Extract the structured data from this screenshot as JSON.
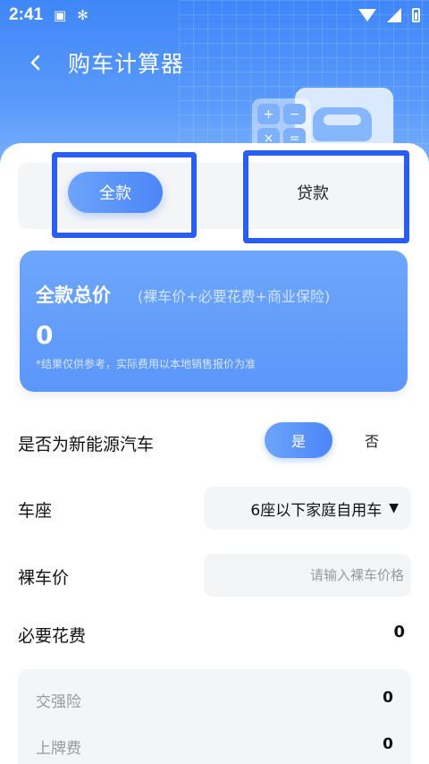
{
  "status_bar": {
    "time": "2:41",
    "icons": [
      "a-icon",
      "bug-icon",
      "wifi-icon",
      "signal-icon",
      "battery-icon"
    ]
  },
  "header": {
    "title": "购车计算器"
  },
  "tabs": {
    "full": "全款",
    "loan": "贷款",
    "selected": "full"
  },
  "total": {
    "title": "全款总价",
    "subtitle": "(裸车价+必要花费+商业保险)",
    "value": "0",
    "note": "*结果仅供参考，实际费用以本地销售报价为准"
  },
  "new_energy": {
    "label": "是否为新能源汽车",
    "yes": "是",
    "no": "否",
    "selected": "yes"
  },
  "seats": {
    "label": "车座",
    "value": "6座以下家庭自用车"
  },
  "bare_price": {
    "label": "裸车价",
    "placeholder": "请输入裸车价格",
    "value": ""
  },
  "required_fees": {
    "label": "必要花费",
    "value": "0",
    "items": [
      {
        "label": "交强险",
        "value": "0"
      },
      {
        "label": "上牌费",
        "value": "0"
      }
    ]
  },
  "colors": {
    "accent": "#4a86f7",
    "highlight": "#2a5ef0",
    "card": "#6ea6fb"
  }
}
